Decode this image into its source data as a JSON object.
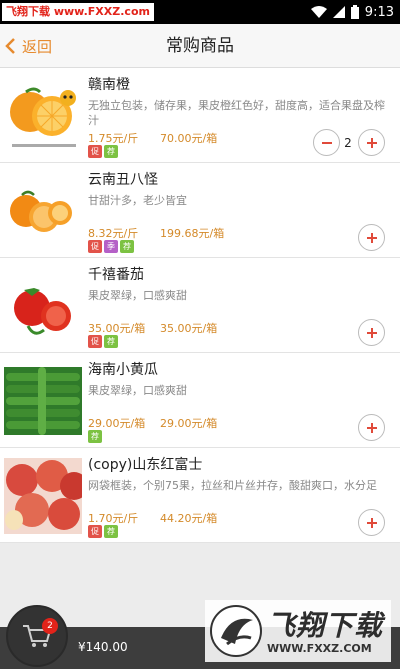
{
  "status_bar": {
    "watermark": "飞翔下载 www.FXXZ.com",
    "time": "9:13"
  },
  "header": {
    "back_label": "返回",
    "title": "常购商品"
  },
  "items": [
    {
      "name": "赣南橙",
      "desc": "无独立包装，储存果，果皮橙红色好，甜度高，适合果盘及榨汁",
      "unit_price": "1.75元/斤",
      "box_price": "70.00元/箱",
      "badges": [
        "促",
        "荐"
      ],
      "quantity": "2",
      "image": "orange-image"
    },
    {
      "name": "云南丑八怪",
      "desc": "甘甜汁多，老少皆宜",
      "unit_price": "8.32元/斤",
      "box_price": "199.68元/箱",
      "badges": [
        "促",
        "季",
        "荐"
      ],
      "image": "tangerine-image"
    },
    {
      "name": "千禧番茄",
      "desc": "果皮翠绿，口感爽甜",
      "unit_price": "35.00元/箱",
      "box_price": "35.00元/箱",
      "badges": [
        "促",
        "荐"
      ],
      "image": "tomato-image"
    },
    {
      "name": "海南小黄瓜",
      "desc": "果皮翠绿，口感爽甜",
      "unit_price": "29.00元/箱",
      "box_price": "29.00元/箱",
      "badges": [
        "荐"
      ],
      "image": "cucumber-image"
    },
    {
      "name": "(copy)山东红富士",
      "desc": "网袋框装，个别75果，拉丝和片丝并存，酸甜爽口，水分足",
      "unit_price": "1.70元/斤",
      "box_price": "44.20元/箱",
      "badges": [
        "促",
        "荐"
      ],
      "image": "apple-image"
    }
  ],
  "cart": {
    "count": "2",
    "total": "¥140.00"
  },
  "watermark_bottom": {
    "big": "飞翔下载",
    "small": "WWW.FXXZ.COM"
  },
  "colors": {
    "accent": "#e68a2e",
    "price": "#d48a2a",
    "badge_red": "#e2534a",
    "badge_green": "#7cc242",
    "badge_purple": "#b560c7",
    "cart_badge": "#e2231a"
  }
}
